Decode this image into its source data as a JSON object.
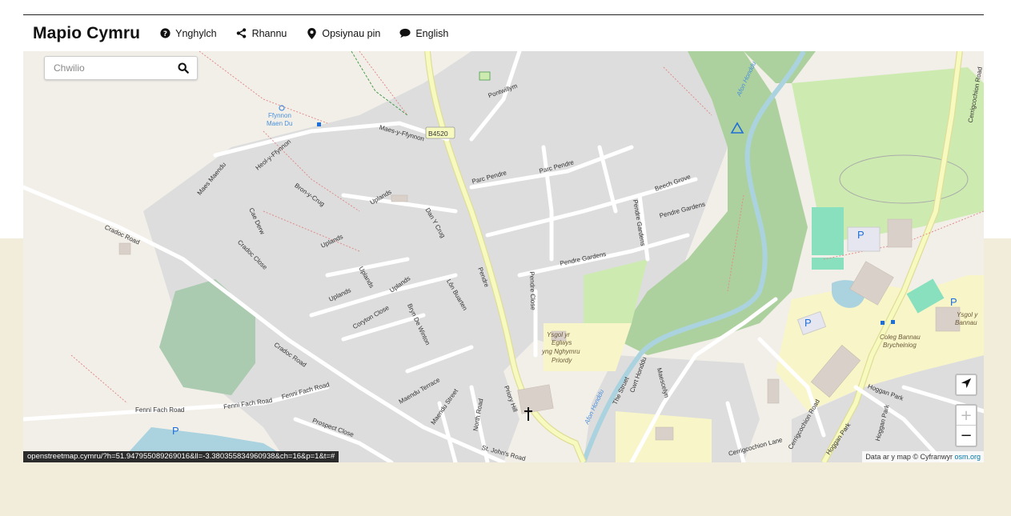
{
  "navbar": {
    "brand": "Mapio Cymru",
    "items": [
      {
        "label": "Ynghylch",
        "icon": "question-circle-icon"
      },
      {
        "label": "Rhannu",
        "icon": "share-icon"
      },
      {
        "label": "Opsiynau pin",
        "icon": "map-pin-icon"
      },
      {
        "label": "English",
        "icon": "speech-bubble-icon"
      }
    ]
  },
  "search": {
    "placeholder": "Chwilio"
  },
  "map": {
    "labels": {
      "ffynnon": "Ffynnon",
      "maen_du": "Maen Du",
      "maes_y_ffynnon": "Maes-y-Ffynnon",
      "b4520": "B4520",
      "pontwillym": "Pontwillym",
      "heol_y_ffynnon": "Heol-y-Ffynnon",
      "maes_maendu": "Maes Maendu",
      "bron_y_crug": "Bron-y-Crug",
      "uplands_1": "Uplands",
      "uplands_2": "Uplands",
      "uplands_3": "Uplands",
      "uplands_4": "Uplands",
      "uplands_5": "Uplands",
      "dan_y_crug": "Dan Y Crug",
      "cae_derw": "Cae Derw",
      "cradoc_road": "Cradoc Road",
      "cradoc_close": "Cradoc Close",
      "parc_pendre_1": "Parc Pendre",
      "parc_pendre_2": "Parc Pendre",
      "beech_grove": "Beech Grove",
      "pendre_gardens_1": "Pendre Gardens",
      "pendre_gardens_2": "Pendre Gardens",
      "pendre_gardens_3": "Pendre Gardens",
      "pendre": "Pendre",
      "pendre_close": "Pendre Close",
      "lon_buarten": "Lôn Buarten",
      "coryton_close": "Coryton Close",
      "bryn_de_winton": "Bryn De Winton",
      "cradoc_road_2": "Cradoc Road",
      "fenni_fach_road_1": "Fenni Fach Road",
      "fenni_fach_road_2": "Fenni Fach Road",
      "fenni_fach_road_3": "Fenni Fach Road",
      "prospect_close": "Prospect Close",
      "maendu_terrace": "Maendu Terrace",
      "maendu_street": "Maendu Street",
      "north_road": "North Road",
      "priory_hill": "Priory Hill",
      "st_johns_road": "St. John's Road",
      "ysgol": "Ysgol yr",
      "eglwys": "Eglwys",
      "ngh": "yng Nghymru",
      "priordy": "Priordy",
      "afon_honddu_1": "Afon Honddu",
      "afon_honddu_2": "Afon Honddu",
      "cwrt_honddu": "Cwrt Honddu",
      "the_struet": "The Struet",
      "maescelyn": "Maescelyn",
      "cerrigcochion_road_1": "Cerrigcochion Road",
      "cerrigcochion_road_2": "Cerrigcochion Road",
      "cerrigcochion_lane": "Cerrigcochion Lane",
      "coleg_1": "Coleg Bannau",
      "coleg_2": "Brycheiniog",
      "ysgol_bannau_1": "Ysgol y",
      "ysgol_bannau_2": "Bannau",
      "hoggan_park_1": "Hoggan Park",
      "hoggan_park_2": "Hoggan Park",
      "hoggan_park_3": "Hoggan Park",
      "parking": "P"
    }
  },
  "controls": {
    "locate_icon": "locate-arrow-icon",
    "zoom_in": "+",
    "zoom_out": "−"
  },
  "attribution": {
    "text": "Data ar y map © Cyfranwyr ",
    "link": "osm.org"
  },
  "status_url": "openstreetmap.cymru/?h=51.947955089269016&ll=-3.380355834960938&ch=16&p=1&t=#"
}
